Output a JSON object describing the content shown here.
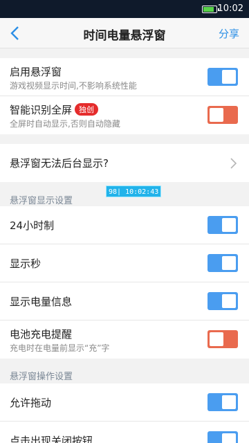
{
  "status_bar": {
    "time": "10:02",
    "battery_level": 0.9
  },
  "nav": {
    "title": "时间电量悬浮窗",
    "share_label": "分享"
  },
  "rows": {
    "enable": {
      "title": "启用悬浮窗",
      "subtitle": "游戏视频显示时间,不影响系统性能",
      "on": true
    },
    "smart_fullscreen": {
      "title": "智能识别全屏",
      "badge": "独创",
      "subtitle": "全屏时自动显示,否则自动隐藏",
      "on": false
    },
    "background_issue": {
      "title": "悬浮窗无法后台显示?"
    },
    "hour24": {
      "title": "24小时制",
      "on": true
    },
    "show_seconds": {
      "title": "显示秒",
      "on": true
    },
    "show_battery": {
      "title": "显示电量信息",
      "on": true
    },
    "charging_hint": {
      "title": "电池充电提醒",
      "subtitle": "充电时在电量前显示“充”字",
      "on": false
    },
    "allow_drag": {
      "title": "允许拖动",
      "on": true
    },
    "click_close": {
      "title": "点击出现关闭按钮",
      "on": true
    }
  },
  "sections": {
    "display": "悬浮窗显示设置",
    "operation": "悬浮窗操作设置"
  },
  "preview": {
    "text": "98| 10:02:43"
  },
  "colors": {
    "accent": "#4a9df0",
    "toggle_off": "#e96a4e",
    "badge": "#e52c2c",
    "status_bar": "#0f1a2b"
  }
}
